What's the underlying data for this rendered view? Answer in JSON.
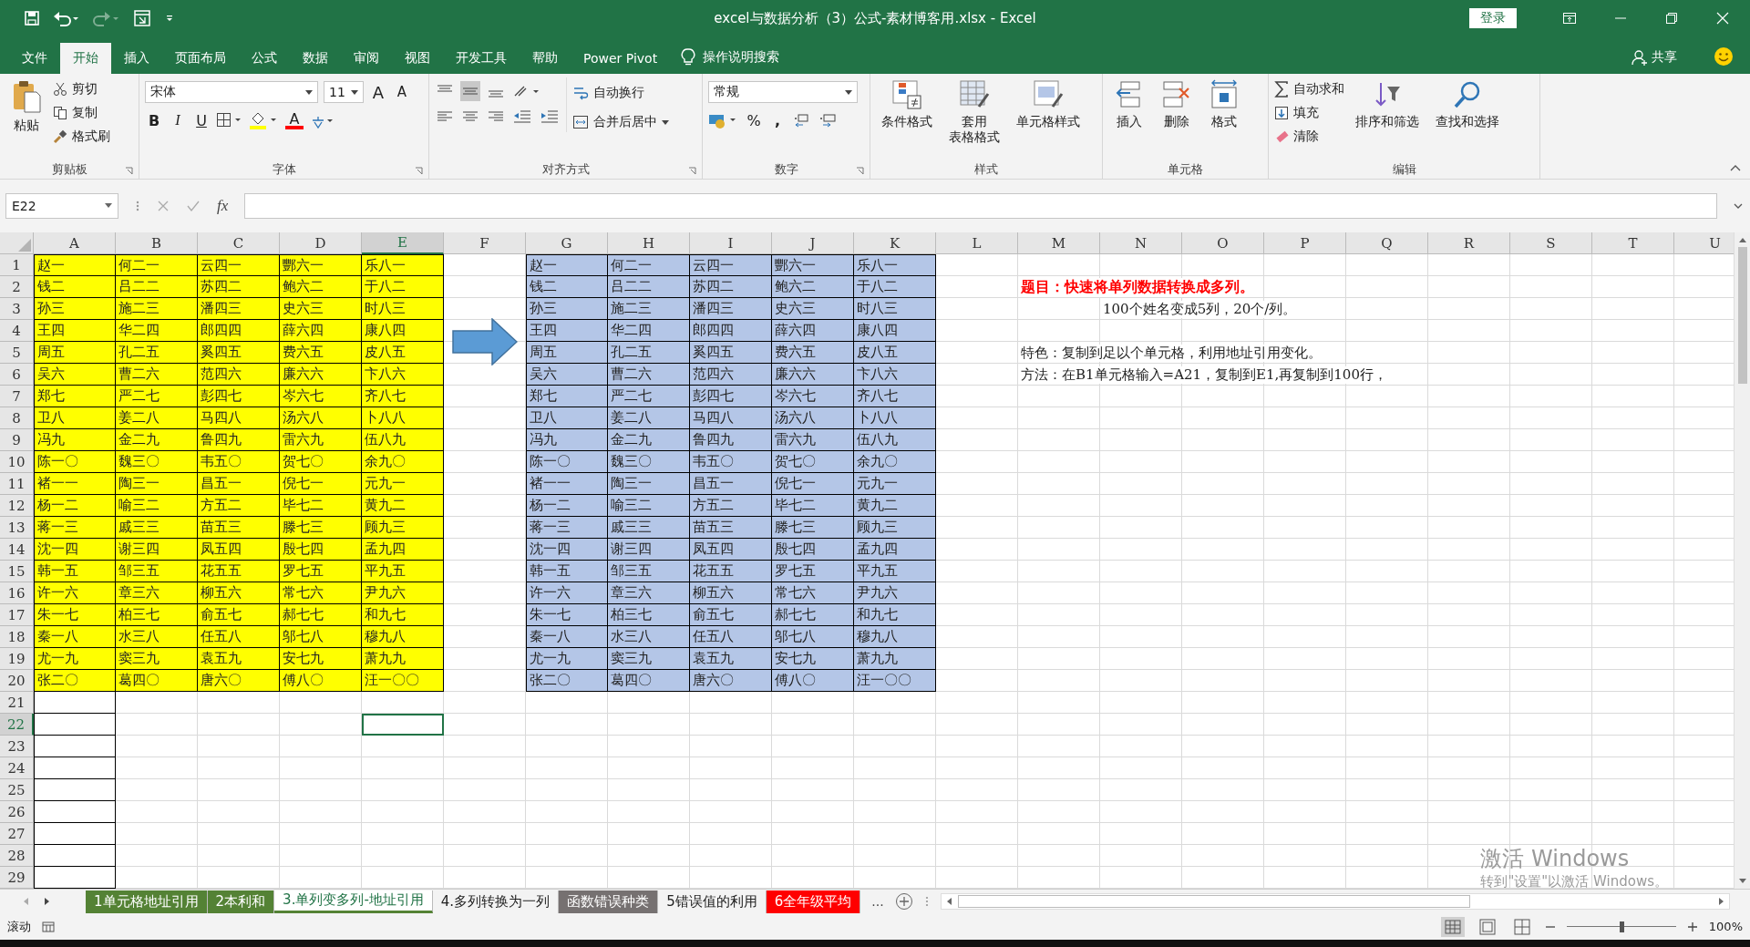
{
  "window": {
    "title": "excel与数据分析（3）公式-素材博客用.xlsx - Excel",
    "sign_in": "登录"
  },
  "menu": {
    "tabs": [
      {
        "label": "文件",
        "selected": false
      },
      {
        "label": "开始",
        "selected": true
      },
      {
        "label": "插入",
        "selected": false
      },
      {
        "label": "页面布局",
        "selected": false
      },
      {
        "label": "公式",
        "selected": false
      },
      {
        "label": "数据",
        "selected": false
      },
      {
        "label": "审阅",
        "selected": false
      },
      {
        "label": "视图",
        "selected": false
      },
      {
        "label": "开发工具",
        "selected": false
      },
      {
        "label": "帮助",
        "selected": false
      },
      {
        "label": "Power Pivot",
        "selected": false
      }
    ],
    "search": "操作说明搜索",
    "share": "共享"
  },
  "ribbon": {
    "clipboard": {
      "paste": "粘贴",
      "cut": "剪切",
      "copy": "复制",
      "format_painter": "格式刷",
      "label": "剪贴板"
    },
    "font": {
      "name": "宋体",
      "size": "11",
      "grow": "A",
      "shrink": "A",
      "bold": "B",
      "italic": "I",
      "underline": "U",
      "font_color": "A",
      "label": "字体"
    },
    "alignment": {
      "wrap": "自动换行",
      "merge": "合并后居中",
      "label": "对齐方式"
    },
    "number": {
      "format": "常规",
      "percent": "%",
      "comma": ",",
      "label": "数字"
    },
    "styles": {
      "conditional": "条件格式",
      "table": [
        "套用",
        "表格格式"
      ],
      "cell_styles": "单元格样式",
      "label": "样式"
    },
    "cells": {
      "insert": "插入",
      "delete": "删除",
      "format": "格式",
      "label": "单元格"
    },
    "editing": {
      "autosum": "自动求和",
      "fill": "填充",
      "clear": "清除",
      "sort": "排序和筛选",
      "find": "查找和选择",
      "label": "编辑"
    }
  },
  "formula_bar": {
    "name_box": "E22",
    "fx": "fx"
  },
  "sheet": {
    "columns": [
      {
        "label": "A",
        "selected": false
      },
      {
        "label": "B",
        "selected": false
      },
      {
        "label": "C",
        "selected": false
      },
      {
        "label": "D",
        "selected": false
      },
      {
        "label": "E",
        "selected": true
      },
      {
        "label": "F",
        "selected": false
      },
      {
        "label": "G",
        "selected": false
      },
      {
        "label": "H",
        "selected": false
      },
      {
        "label": "I",
        "selected": false
      },
      {
        "label": "J",
        "selected": false
      },
      {
        "label": "K",
        "selected": false
      },
      {
        "label": "L",
        "selected": false
      },
      {
        "label": "M",
        "selected": false
      },
      {
        "label": "N",
        "selected": false
      },
      {
        "label": "O",
        "selected": false
      },
      {
        "label": "P",
        "selected": false
      },
      {
        "label": "Q",
        "selected": false
      },
      {
        "label": "R",
        "selected": false
      },
      {
        "label": "S",
        "selected": false
      },
      {
        "label": "T",
        "selected": false
      },
      {
        "label": "U",
        "selected": false
      }
    ],
    "rows": [
      {
        "label": "1",
        "selected": false
      },
      {
        "label": "2",
        "selected": false
      },
      {
        "label": "3",
        "selected": false
      },
      {
        "label": "4",
        "selected": false
      },
      {
        "label": "5",
        "selected": false
      },
      {
        "label": "6",
        "selected": false
      },
      {
        "label": "7",
        "selected": false
      },
      {
        "label": "8",
        "selected": false
      },
      {
        "label": "9",
        "selected": false
      },
      {
        "label": "10",
        "selected": false
      },
      {
        "label": "11",
        "selected": false
      },
      {
        "label": "12",
        "selected": false
      },
      {
        "label": "13",
        "selected": false
      },
      {
        "label": "14",
        "selected": false
      },
      {
        "label": "15",
        "selected": false
      },
      {
        "label": "16",
        "selected": false
      },
      {
        "label": "17",
        "selected": false
      },
      {
        "label": "18",
        "selected": false
      },
      {
        "label": "19",
        "selected": false
      },
      {
        "label": "20",
        "selected": false
      },
      {
        "label": "21",
        "selected": false
      },
      {
        "label": "22",
        "selected": true
      },
      {
        "label": "23",
        "selected": false
      },
      {
        "label": "24",
        "selected": false
      },
      {
        "label": "25",
        "selected": false
      },
      {
        "label": "26",
        "selected": false
      },
      {
        "label": "27",
        "selected": false
      },
      {
        "label": "28",
        "selected": false
      },
      {
        "label": "29",
        "selected": false
      }
    ],
    "source_table": [
      [
        "赵一",
        "何二一",
        "云四一",
        "酆六一",
        "乐八一"
      ],
      [
        "钱二",
        "吕二二",
        "苏四二",
        "鲍六二",
        "于八二"
      ],
      [
        "孙三",
        "施二三",
        "潘四三",
        "史六三",
        "时八三"
      ],
      [
        "王四",
        "华二四",
        "郎四四",
        "薛六四",
        "康八四"
      ],
      [
        "周五",
        "孔二五",
        "奚四五",
        "费六五",
        "皮八五"
      ],
      [
        "吴六",
        "曹二六",
        "范四六",
        "廉六六",
        "卞八六"
      ],
      [
        "郑七",
        "严二七",
        "彭四七",
        "岑六七",
        "齐八七"
      ],
      [
        "卫八",
        "姜二八",
        "马四八",
        "汤六八",
        "卜八八"
      ],
      [
        "冯九",
        "金二九",
        "鲁四九",
        "雷六九",
        "伍八九"
      ],
      [
        "陈一〇",
        "魏三〇",
        "韦五〇",
        "贺七〇",
        "余九〇"
      ],
      [
        "褚一一",
        "陶三一",
        "昌五一",
        "倪七一",
        "元九一"
      ],
      [
        "杨一二",
        "喻三二",
        "方五二",
        "毕七二",
        "黄九二"
      ],
      [
        "蒋一三",
        "戚三三",
        "苗五三",
        "滕七三",
        "顾九三"
      ],
      [
        "沈一四",
        "谢三四",
        "凤五四",
        "殷七四",
        "孟九四"
      ],
      [
        "韩一五",
        "邹三五",
        "花五五",
        "罗七五",
        "平九五"
      ],
      [
        "许一六",
        "章三六",
        "柳五六",
        "常七六",
        "尹九六"
      ],
      [
        "朱一七",
        "柏三七",
        "俞五七",
        "郝七七",
        "和九七"
      ],
      [
        "秦一八",
        "水三八",
        "任五八",
        "邬七八",
        "穆九八"
      ],
      [
        "尤一九",
        "窦三九",
        "袁五九",
        "安七九",
        "萧九九"
      ],
      [
        "张二〇",
        "葛四〇",
        "唐六〇",
        "傅八〇",
        "汪一〇〇"
      ]
    ],
    "result_table": [
      [
        "赵一",
        "何二一",
        "云四一",
        "酆六一",
        "乐八一"
      ],
      [
        "钱二",
        "吕二二",
        "苏四二",
        "鲍六二",
        "于八二"
      ],
      [
        "孙三",
        "施二三",
        "潘四三",
        "史六三",
        "时八三"
      ],
      [
        "王四",
        "华二四",
        "郎四四",
        "薛六四",
        "康八四"
      ],
      [
        "周五",
        "孔二五",
        "奚四五",
        "费六五",
        "皮八五"
      ],
      [
        "吴六",
        "曹二六",
        "范四六",
        "廉六六",
        "卞八六"
      ],
      [
        "郑七",
        "严二七",
        "彭四七",
        "岑六七",
        "齐八七"
      ],
      [
        "卫八",
        "姜二八",
        "马四八",
        "汤六八",
        "卜八八"
      ],
      [
        "冯九",
        "金二九",
        "鲁四九",
        "雷六九",
        "伍八九"
      ],
      [
        "陈一〇",
        "魏三〇",
        "韦五〇",
        "贺七〇",
        "余九〇"
      ],
      [
        "褚一一",
        "陶三一",
        "昌五一",
        "倪七一",
        "元九一"
      ],
      [
        "杨一二",
        "喻三二",
        "方五二",
        "毕七二",
        "黄九二"
      ],
      [
        "蒋一三",
        "戚三三",
        "苗五三",
        "滕七三",
        "顾九三"
      ],
      [
        "沈一四",
        "谢三四",
        "凤五四",
        "殷七四",
        "孟九四"
      ],
      [
        "韩一五",
        "邹三五",
        "花五五",
        "罗七五",
        "平九五"
      ],
      [
        "许一六",
        "章三六",
        "柳五六",
        "常七六",
        "尹九六"
      ],
      [
        "朱一七",
        "柏三七",
        "俞五七",
        "郝七七",
        "和九七"
      ],
      [
        "秦一八",
        "水三八",
        "任五八",
        "邬七八",
        "穆九八"
      ],
      [
        "尤一九",
        "窦三九",
        "袁五九",
        "安七九",
        "萧九九"
      ],
      [
        "张二〇",
        "葛四〇",
        "唐六〇",
        "傅八〇",
        "汪一〇〇"
      ]
    ],
    "notes": [
      {
        "kind": "title",
        "text": "题目：快速将单列数据转换成多列。"
      },
      {
        "kind": "detail",
        "text": "100个姓名变成5列，20个/列。"
      },
      {
        "kind": "text",
        "text": "特色：复制到足以个单元格，利用地址引用变化。"
      },
      {
        "kind": "text",
        "text": "方法：在B1单元格输入=A21，复制到E1,再复制到100行，"
      }
    ]
  },
  "sheet_tabs": [
    {
      "label": "1单元格地址引用",
      "selected": false,
      "color": "#548235"
    },
    {
      "label": "2本利和",
      "selected": false,
      "color": "#548235"
    },
    {
      "label": "3.单列变多列-地址引用",
      "selected": true,
      "color": "#548235"
    },
    {
      "label": "4.多列转换为一列",
      "selected": false
    },
    {
      "label": "函数错误种类",
      "selected": false,
      "color": "#767171"
    },
    {
      "label": "5错误值的利用",
      "selected": false
    },
    {
      "label": "6全年级平均",
      "selected": false,
      "color": "#ff0000"
    }
  ],
  "more_tabs": "...",
  "status_bar": {
    "mode": "滚动",
    "zoom": "100%",
    "level": 0.5
  },
  "activation": {
    "title": "激活 Windows",
    "hint": "转到\"设置\"以激活 Windows。"
  }
}
